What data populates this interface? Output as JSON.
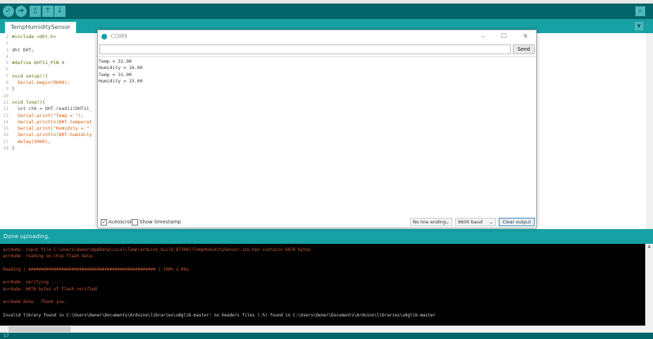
{
  "toolbar": {
    "buttons": [
      {
        "name": "verify",
        "icon": "check-icon"
      },
      {
        "name": "upload",
        "icon": "arrow-right-icon"
      },
      {
        "name": "new",
        "icon": "file-icon"
      },
      {
        "name": "open",
        "icon": "arrow-up-icon"
      },
      {
        "name": "save",
        "icon": "arrow-down-icon"
      }
    ],
    "serial_monitor_icon": "magnifier-icon"
  },
  "tab": {
    "label": "TempHumiditySensor"
  },
  "code": [
    {
      "n": "1",
      "t": "#include <dht.h>"
    },
    {
      "n": "2",
      "t": ""
    },
    {
      "n": "3",
      "t": "dht DHT;"
    },
    {
      "n": "4",
      "t": ""
    },
    {
      "n": "5",
      "t": "#define DHT11_PIN 4"
    },
    {
      "n": "6",
      "t": ""
    },
    {
      "n": "7",
      "t": "void setup(){"
    },
    {
      "n": "8",
      "t": "  Serial.begin(9600);"
    },
    {
      "n": "9",
      "t": "}"
    },
    {
      "n": "10",
      "t": ""
    },
    {
      "n": "11",
      "t": "void loop(){"
    },
    {
      "n": "12",
      "t": "  int chk = DHT.read11(DHT11_"
    },
    {
      "n": "13",
      "t": "  Serial.print(\"Temp = \");"
    },
    {
      "n": "14",
      "t": "  Serial.println(DHT.temperat"
    },
    {
      "n": "15",
      "t": "  Serial.print(\"Humidity = \""
    },
    {
      "n": "16",
      "t": "  Serial.println(DHT.humidity"
    },
    {
      "n": "17",
      "t": "  delay(5000);"
    },
    {
      "n": "18",
      "t": "}"
    }
  ],
  "monitor": {
    "title": "COM9",
    "input_value": "",
    "send_label": "Send",
    "output": [
      "Temp = 31.00",
      "Humidity = 16.00",
      "Temp = 31.00",
      "Humidity = 15.00"
    ],
    "autoscroll_label": "Autoscroll",
    "autoscroll_checked": true,
    "timestamp_label": "Show timestamp",
    "timestamp_checked": false,
    "line_ending": "No line ending",
    "baud": "9600 baud",
    "clear_label": "Clear output"
  },
  "console": {
    "header": "Done uploading.",
    "lines": [
      {
        "t": "avrdude: input file C:\\Users\\Owner\\AppData\\Local\\Temp\\arduino_build_873087/TempHumiditySensor.ino.hex contains 6078 bytes",
        "c": "r"
      },
      {
        "t": "avrdude: reading on-chip flash data:",
        "c": "r"
      },
      {
        "t": "",
        "c": "r"
      },
      {
        "t": "Reading | ################################################## | 100% 2.06s",
        "c": "r"
      },
      {
        "t": "",
        "c": "r"
      },
      {
        "t": "avrdude: verifying ...",
        "c": "r"
      },
      {
        "t": "avrdude: 6078 bytes of flash verified",
        "c": "r"
      },
      {
        "t": "",
        "c": "r"
      },
      {
        "t": "avrdude done.  Thank you.",
        "c": "r"
      },
      {
        "t": "",
        "c": "r"
      },
      {
        "t": "Invalid library found in C:\\Users\\Owner\\Documents\\Arduino\\libraries\\u8glib-master: no headers files (.h) found in C:\\Users\\Owner\\Documents\\Arduino\\libraries\\u8glib-master",
        "c": "w"
      }
    ]
  },
  "status": {
    "line": "17"
  },
  "colors": {
    "toolbar": "#006468",
    "accent": "#17a1a5",
    "console_bg": "#000000",
    "console_text": "#d35c3a"
  }
}
